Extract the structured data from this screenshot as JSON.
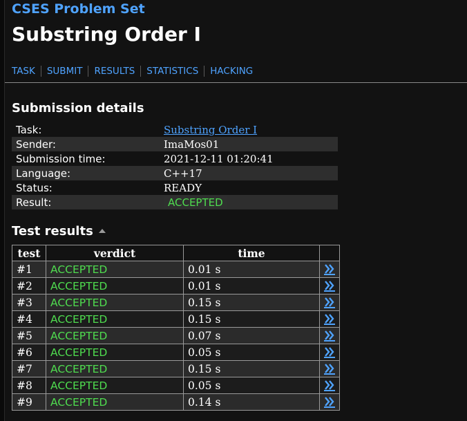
{
  "header": {
    "site_title": "CSES Problem Set",
    "page_title": "Substring Order I"
  },
  "nav": {
    "items": [
      "TASK",
      "SUBMIT",
      "RESULTS",
      "STATISTICS",
      "HACKING"
    ]
  },
  "submission": {
    "section_title": "Submission details",
    "rows": [
      {
        "label": "Task:",
        "value": "Substring Order I"
      },
      {
        "label": "Sender:",
        "value": "ImaMos01"
      },
      {
        "label": "Submission time:",
        "value": "2021-12-11 01:20:41"
      },
      {
        "label": "Language:",
        "value": "C++17"
      },
      {
        "label": "Status:",
        "value": "READY"
      },
      {
        "label": "Result:",
        "value": "ACCEPTED"
      }
    ]
  },
  "tests": {
    "section_title": "Test results",
    "columns": [
      "test",
      "verdict",
      "time"
    ],
    "rows": [
      {
        "test": "#1",
        "verdict": "ACCEPTED",
        "time": "0.01 s"
      },
      {
        "test": "#2",
        "verdict": "ACCEPTED",
        "time": "0.01 s"
      },
      {
        "test": "#3",
        "verdict": "ACCEPTED",
        "time": "0.15 s"
      },
      {
        "test": "#4",
        "verdict": "ACCEPTED",
        "time": "0.15 s"
      },
      {
        "test": "#5",
        "verdict": "ACCEPTED",
        "time": "0.07 s"
      },
      {
        "test": "#6",
        "verdict": "ACCEPTED",
        "time": "0.05 s"
      },
      {
        "test": "#7",
        "verdict": "ACCEPTED",
        "time": "0.15 s"
      },
      {
        "test": "#8",
        "verdict": "ACCEPTED",
        "time": "0.05 s"
      },
      {
        "test": "#9",
        "verdict": "ACCEPTED",
        "time": "0.14 s"
      }
    ],
    "row_link_icon": "double-chevron-right-icon"
  },
  "colors": {
    "link": "#4fa3ff",
    "accepted": "#4fdc4f",
    "background": "#121212"
  }
}
